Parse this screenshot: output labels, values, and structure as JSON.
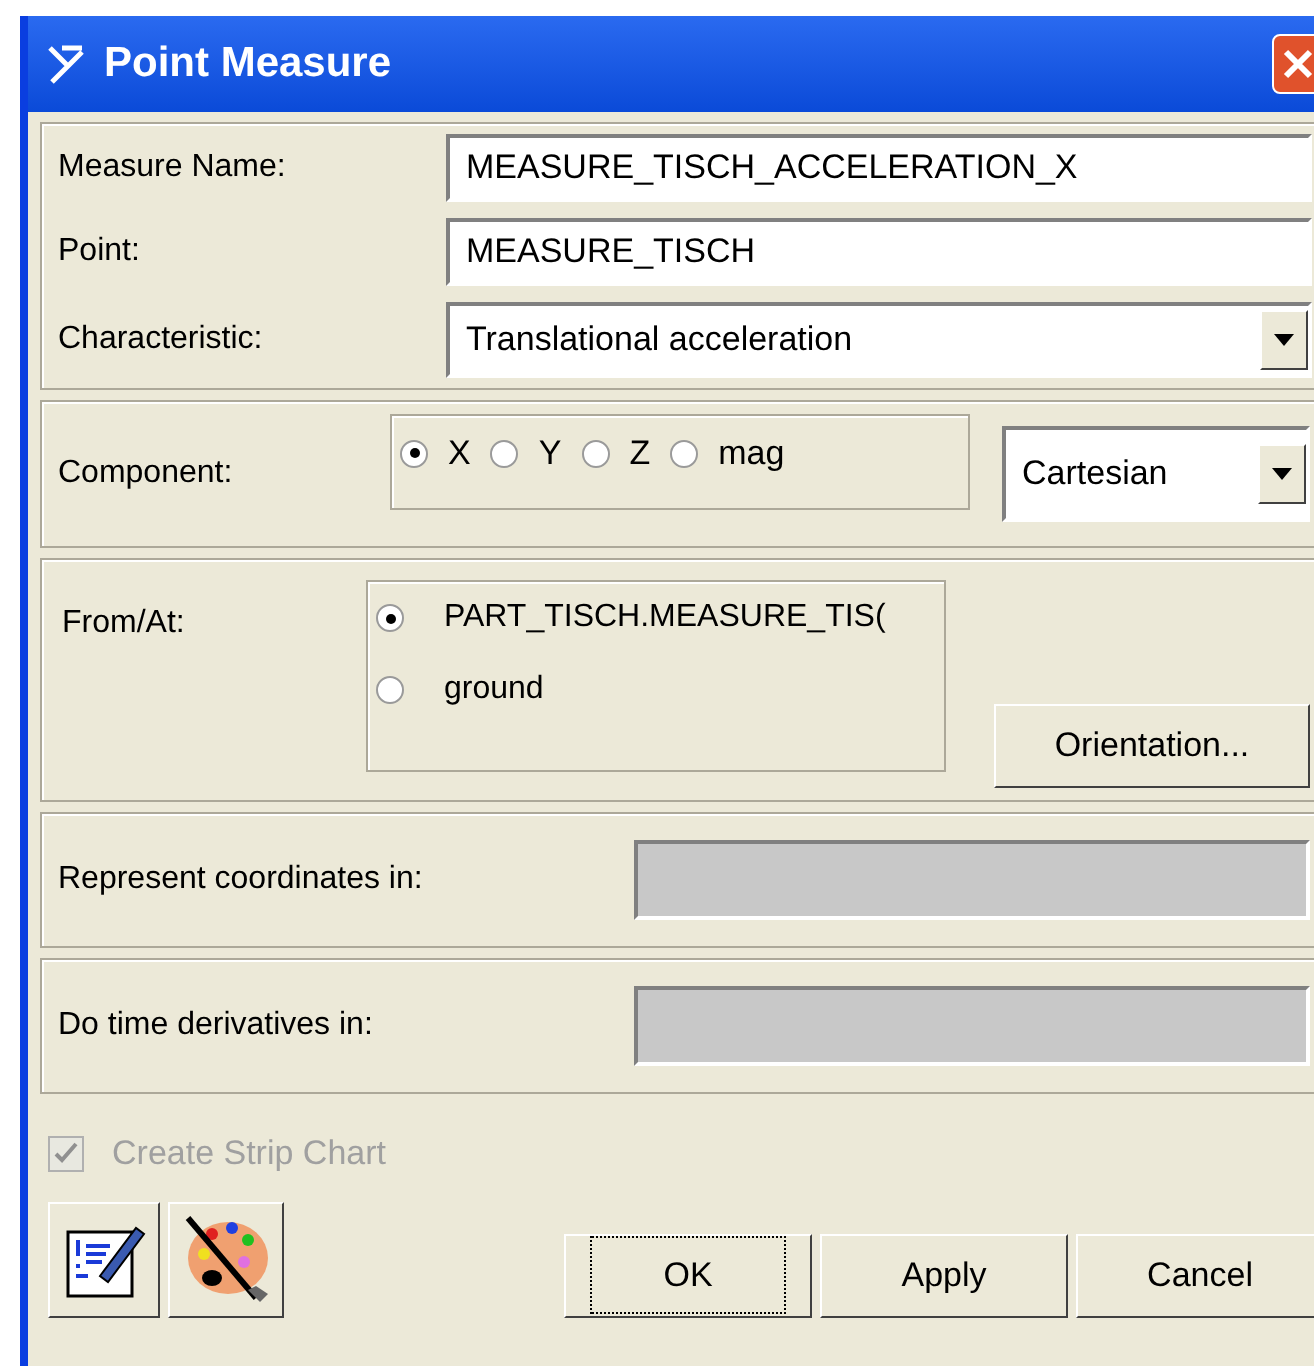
{
  "window": {
    "title": "Point Measure"
  },
  "measure_name": {
    "label": "Measure Name:",
    "value": "MEASURE_TISCH_ACCELERATION_X"
  },
  "point": {
    "label": "Point:",
    "value": "MEASURE_TISCH"
  },
  "characteristic": {
    "label": "Characteristic:",
    "value": "Translational acceleration"
  },
  "component": {
    "label": "Component:",
    "options": [
      {
        "label": "X",
        "selected": true
      },
      {
        "label": "Y",
        "selected": false
      },
      {
        "label": "Z",
        "selected": false
      },
      {
        "label": "mag",
        "selected": false
      }
    ],
    "coordinate_system": "Cartesian"
  },
  "from_at": {
    "label": "From/At:",
    "options": [
      {
        "label": "PART_TISCH.MEASURE_TIS(",
        "selected": true
      },
      {
        "label": "ground",
        "selected": false
      }
    ],
    "button": "Orientation..."
  },
  "represent_coordinates": {
    "label": "Represent coordinates in:"
  },
  "time_derivatives": {
    "label": "Do time derivatives in:"
  },
  "strip_chart": {
    "label": "Create Strip Chart",
    "checked": true,
    "disabled": true
  },
  "buttons": [
    {
      "label": "OK",
      "focused": true
    },
    {
      "label": "Apply",
      "focused": false
    },
    {
      "label": "Cancel",
      "focused": false
    }
  ]
}
